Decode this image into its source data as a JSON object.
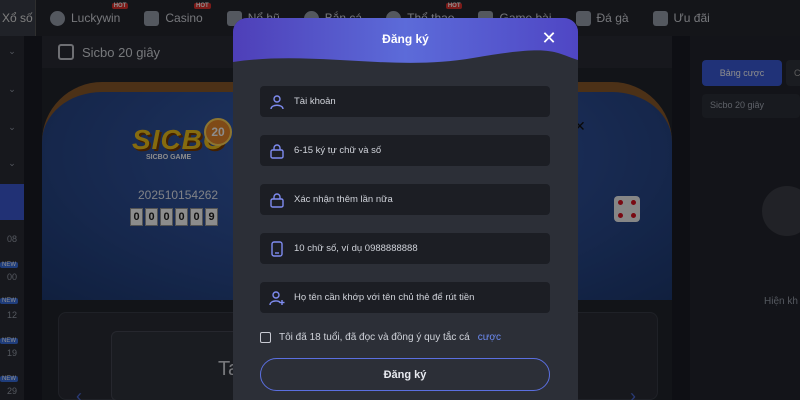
{
  "nav": {
    "first_label": "Xổ số",
    "items": [
      {
        "label": "Luckywin",
        "icon": "luckywin-icon",
        "badge": "HOT"
      },
      {
        "label": "Casino",
        "icon": "casino-icon",
        "badge": "HOT"
      },
      {
        "label": "Nổ hũ",
        "icon": "slot-icon",
        "badge": ""
      },
      {
        "label": "Bắn cá",
        "icon": "fish-icon",
        "badge": ""
      },
      {
        "label": "Thể thao",
        "icon": "sport-icon",
        "badge": "HOT"
      },
      {
        "label": "Game bài",
        "icon": "cards-icon",
        "badge": ""
      },
      {
        "label": "Đá gà",
        "icon": "rooster-icon",
        "badge": ""
      },
      {
        "label": "Ưu đãi",
        "icon": "gift-icon",
        "badge": ""
      }
    ]
  },
  "rail": {
    "new_badge": "NEW",
    "numbers": [
      "08",
      "00",
      "12",
      "19",
      "29"
    ]
  },
  "game": {
    "title": "Sicbo 20 giây",
    "logo_text": "SICBO",
    "logo_number": "20",
    "logo_sub": "SICBO GAME",
    "round_id": "202510154262",
    "digits": [
      "0",
      "0",
      "0",
      "0",
      "0",
      "9"
    ],
    "lower_letter": "Ta",
    "lower_small": "x"
  },
  "right_panel": {
    "tab_active": "Bảng cược",
    "tab_inactive": "Ch",
    "select_value": "Sicbo 20 giây",
    "empty_text": "Hiện kh"
  },
  "modal": {
    "title": "Đăng ký",
    "fields": [
      {
        "placeholder": "Tài khoản",
        "icon": "user-icon"
      },
      {
        "placeholder": "6-15 ký tự chữ và số",
        "icon": "lock-icon"
      },
      {
        "placeholder": "Xác nhận thêm lần nữa",
        "icon": "lock-icon"
      },
      {
        "placeholder": "10 chữ số, ví dụ 0988888888",
        "icon": "phone-icon"
      },
      {
        "placeholder": "Họ tên cần khớp với tên chủ thẻ để rút tiền",
        "icon": "add-user-icon"
      }
    ],
    "agree_text": "Tôi đã 18 tuổi, đã đọc và đồng ý quy tắc cá",
    "agree_link": "cược",
    "submit_label": "Đăng ký"
  },
  "colors": {
    "accent": "#5b6fe0",
    "header_gradient_start": "#4e3fb8",
    "header_gradient_end": "#5c6bd9",
    "hot_badge": "#e0322f",
    "new_badge": "#3a6fe0",
    "link": "#6d8cf5"
  }
}
